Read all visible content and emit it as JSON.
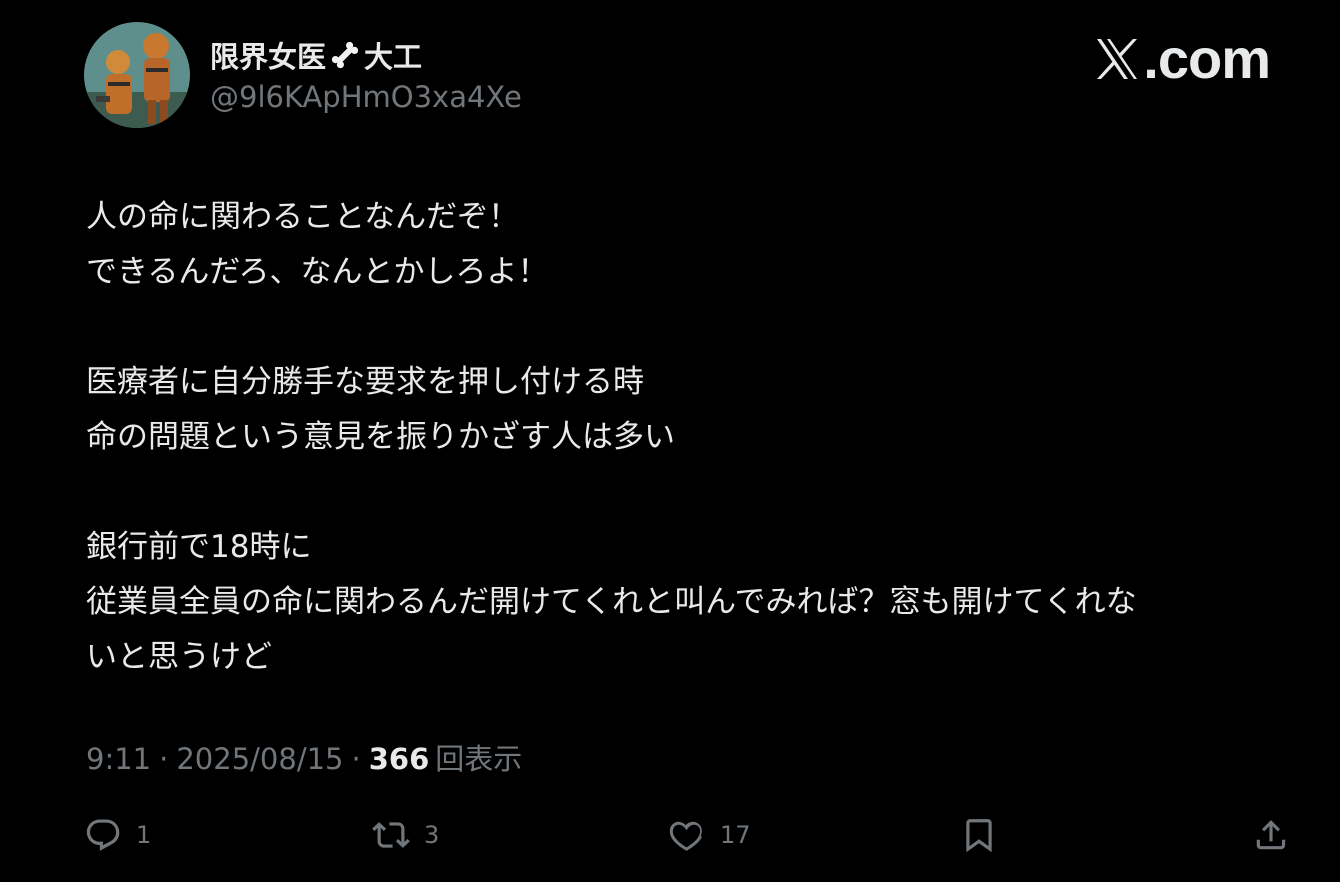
{
  "user": {
    "display_name_prefix": "限界女医",
    "display_name_suffix": "大工",
    "handle": "@9l6KApHmO3xa4Xe"
  },
  "brand": {
    "text": ".com"
  },
  "tweet": {
    "lines": [
      "人の命に関わることなんだぞ！",
      "できるんだろ、なんとかしろよ！",
      "",
      "医療者に自分勝手な要求を押し付ける時",
      "命の問題という意見を振りかざす人は多い",
      "",
      "銀行前で18時に",
      "従業員全員の命に関わるんだ開けてくれと叫んでみれば？窓も開けてくれな",
      "いと思うけど"
    ]
  },
  "meta": {
    "time": "9:11",
    "separator": "·",
    "date": "2025/08/15",
    "views_count": "366",
    "views_label": "回表示"
  },
  "actions": {
    "replies": "1",
    "reposts": "3",
    "likes": "17"
  },
  "colors": {
    "background": "#000000",
    "text_primary": "#e7e9ea",
    "text_secondary": "#71767b"
  }
}
